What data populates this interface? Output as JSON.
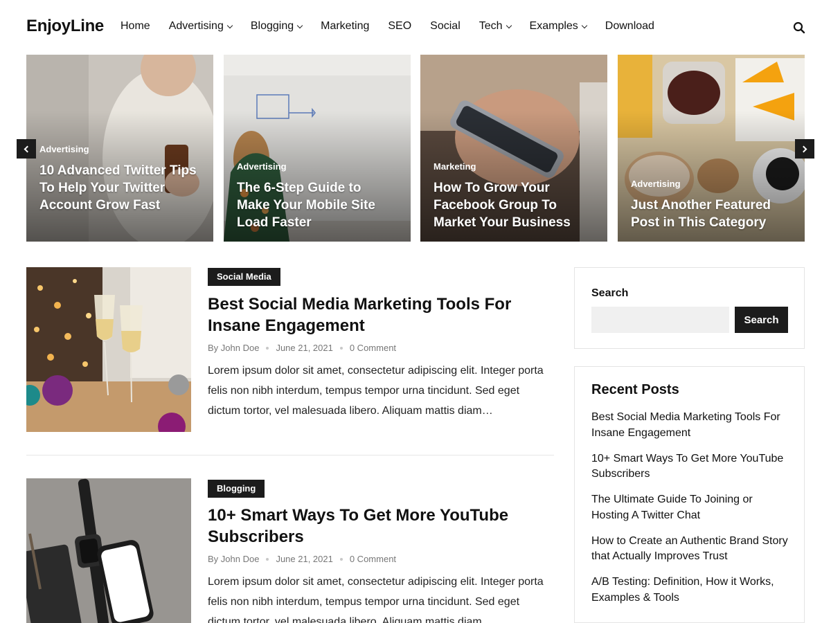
{
  "site": {
    "logo": "EnjoyLine"
  },
  "nav": {
    "items": [
      {
        "label": "Home",
        "dropdown": false
      },
      {
        "label": "Advertising",
        "dropdown": true
      },
      {
        "label": "Blogging",
        "dropdown": true
      },
      {
        "label": "Marketing",
        "dropdown": false
      },
      {
        "label": "SEO",
        "dropdown": false
      },
      {
        "label": "Social",
        "dropdown": false
      },
      {
        "label": "Tech",
        "dropdown": true
      },
      {
        "label": "Examples",
        "dropdown": true
      },
      {
        "label": "Download",
        "dropdown": false
      }
    ],
    "search_icon": "search-icon"
  },
  "slider": {
    "slides": [
      {
        "category": "Advertising",
        "title": "10 Advanced Twitter Tips To Help Your Twitter Account Grow Fast"
      },
      {
        "category": "Advertising",
        "title": "The 6-Step Guide to Make Your Mobile Site Load Faster"
      },
      {
        "category": "Marketing",
        "title": "How To Grow Your Facebook Group To Market Your Business"
      },
      {
        "category": "Advertising",
        "title": "Just Another Featured Post in This Category"
      }
    ],
    "prev_icon": "chevron-left-icon",
    "next_icon": "chevron-right-icon"
  },
  "posts": [
    {
      "category": "Social Media",
      "title": "Best Social Media Marketing Tools For Insane Engagement",
      "author": "By John Doe",
      "date": "June 21, 2021",
      "comments": "0 Comment",
      "excerpt": "Lorem ipsum dolor sit amet, consectetur adipiscing elit. Integer porta felis non nibh interdum, tempus tempor urna tincidunt. Sed eget dictum tortor, vel malesuada libero. Aliquam mattis diam…"
    },
    {
      "category": "Blogging",
      "title": "10+ Smart Ways To Get More YouTube Subscribers",
      "author": "By John Doe",
      "date": "June 21, 2021",
      "comments": "0 Comment",
      "excerpt": "Lorem ipsum dolor sit amet, consectetur adipiscing elit. Integer porta felis non nibh interdum, tempus tempor urna tincidunt. Sed eget dictum tortor, vel malesuada libero. Aliquam mattis diam…"
    }
  ],
  "sidebar": {
    "search": {
      "title": "Search",
      "button": "Search",
      "placeholder": ""
    },
    "recent": {
      "title": "Recent Posts",
      "items": [
        "Best Social Media Marketing Tools For Insane Engagement",
        "10+ Smart Ways To Get More YouTube Subscribers",
        "The Ultimate Guide To Joining or Hosting A Twitter Chat",
        "How to Create an Authentic Brand Story that Actually Improves Trust",
        "A/B Testing: Definition, How it Works, Examples & Tools"
      ]
    }
  }
}
